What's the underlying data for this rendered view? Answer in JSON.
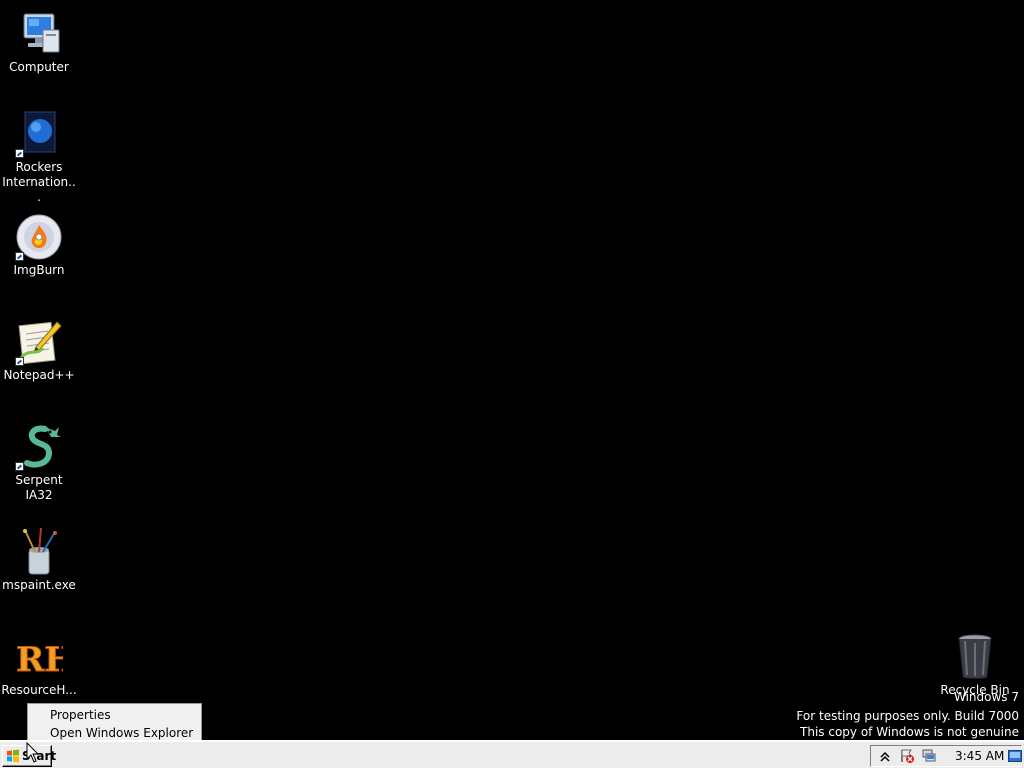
{
  "desktop": {
    "icons": [
      {
        "label": "Computer",
        "icon": "computer-icon",
        "shortcut": false
      },
      {
        "label": "Rockers Internation...",
        "icon": "rockers-document-icon",
        "shortcut": true
      },
      {
        "label": "ImgBurn",
        "icon": "imgburn-disc-icon",
        "shortcut": true
      },
      {
        "label": "Notepad++",
        "icon": "notepadpp-icon",
        "shortcut": true
      },
      {
        "label": "Serpent IA32",
        "icon": "serpent-icon",
        "shortcut": true
      },
      {
        "label": "mspaint.exe",
        "icon": "mspaint-icon",
        "shortcut": false
      },
      {
        "label": "ResourceH...",
        "icon": "resourcehacker-icon",
        "shortcut": false
      },
      {
        "label": "Recycle Bin",
        "icon": "recycle-bin-icon",
        "shortcut": false
      }
    ]
  },
  "context_menu": {
    "items": [
      {
        "label": "Properties"
      },
      {
        "label": "Open Windows Explorer"
      }
    ]
  },
  "watermark": {
    "line1": "Windows 7",
    "line2": "For testing purposes only. Build 7000",
    "line3": "This copy of Windows is not genuine"
  },
  "taskbar": {
    "start_label": "Start",
    "clock": "3:45 AM",
    "tray_icons": [
      "show-hidden-icons-chevron-icon",
      "action-center-warning-icon",
      "network-icon"
    ]
  },
  "colors": {
    "desktop_background": "#000000",
    "taskbar": "#ececec",
    "menu_background": "#f0f0f0"
  }
}
